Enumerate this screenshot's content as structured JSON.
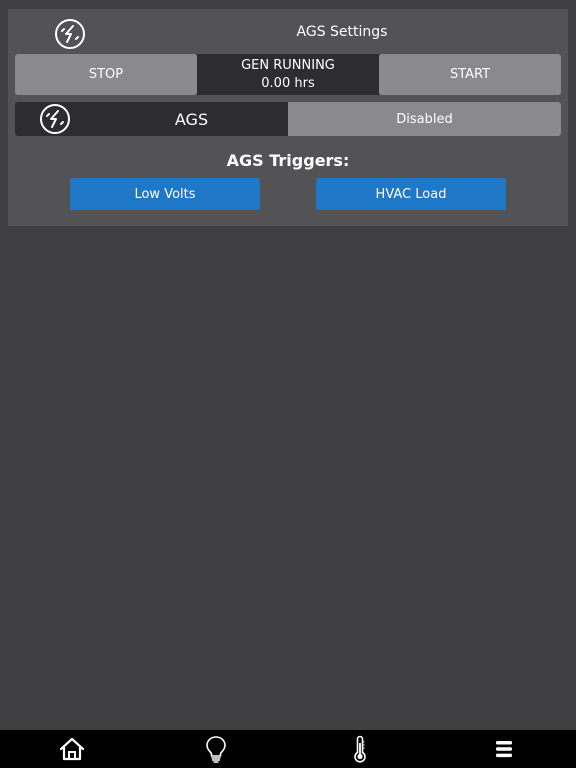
{
  "header": {
    "title": "AGS Settings",
    "icon": "generator-bolt-icon"
  },
  "generator": {
    "stop_label": "STOP",
    "start_label": "START",
    "status_label": "GEN RUNNING",
    "runtime": "0.00 hrs"
  },
  "ags": {
    "label": "AGS",
    "state": "Disabled",
    "icon": "generator-bolt-icon"
  },
  "triggers": {
    "title": "AGS Triggers:",
    "items": [
      {
        "label": "Low Volts"
      },
      {
        "label": "HVAC Load"
      }
    ],
    "color": "#1f77c8"
  },
  "tabbar": {
    "items": [
      {
        "icon": "home-icon"
      },
      {
        "icon": "lightbulb-icon"
      },
      {
        "icon": "thermometer-icon"
      },
      {
        "icon": "menu-icon"
      }
    ]
  }
}
